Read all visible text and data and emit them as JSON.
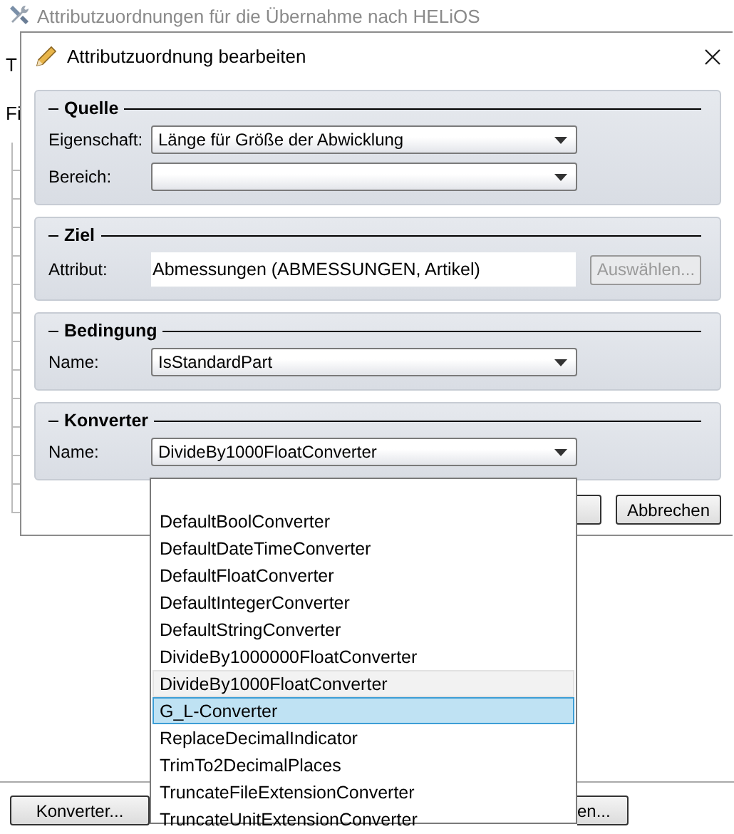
{
  "background_window": {
    "title": "Attributzuordnungen für die Übernahme nach HELiOS",
    "labels": [
      "T",
      "Fi"
    ],
    "buttons": [
      {
        "label": "Konverter..."
      },
      {
        "label": "en..."
      }
    ]
  },
  "dialog": {
    "title": "Attributzuordnung bearbeiten",
    "groups": [
      {
        "title": "Quelle",
        "fields": [
          {
            "kind": "combo",
            "label": "Eigenschaft:",
            "value": "Länge für Größe der Abwicklung"
          },
          {
            "kind": "combo",
            "label": "Bereich:"
          }
        ]
      },
      {
        "title": "Ziel",
        "fields": [
          {
            "kind": "text",
            "label": "Attribut:",
            "value": "Abmessungen (ABMESSUNGEN, Artikel)",
            "button": {
              "label": "Auswählen...",
              "disabled": true
            }
          }
        ]
      },
      {
        "title": "Bedingung",
        "fields": [
          {
            "kind": "combo",
            "label": "Name:",
            "value": "IsStandardPart"
          }
        ]
      },
      {
        "title": "Konverter",
        "fields": [
          {
            "kind": "combo",
            "label": "Name:",
            "value": "DivideBy1000FloatConverter"
          }
        ]
      }
    ],
    "buttons": [
      {
        "label": "Abbrechen"
      }
    ]
  },
  "dropdown": {
    "items": [
      {
        "label": "DefaultBoolConverter",
        "current": false,
        "selected": false
      },
      {
        "label": "DefaultDateTimeConverter",
        "current": false,
        "selected": false
      },
      {
        "label": "DefaultFloatConverter",
        "current": false,
        "selected": false
      },
      {
        "label": "DefaultIntegerConverter",
        "current": false,
        "selected": false
      },
      {
        "label": "DefaultStringConverter",
        "current": false,
        "selected": false
      },
      {
        "label": "DivideBy1000000FloatConverter",
        "current": false,
        "selected": false
      },
      {
        "label": "DivideBy1000FloatConverter",
        "current": true,
        "selected": false
      },
      {
        "label": "G_L-Converter",
        "current": false,
        "selected": true
      },
      {
        "label": "ReplaceDecimalIndicator",
        "current": false,
        "selected": false
      },
      {
        "label": "TrimTo2DecimalPlaces",
        "current": false,
        "selected": false
      },
      {
        "label": "TruncateFileExtensionConverter",
        "current": false,
        "selected": false
      },
      {
        "label": "TruncateUnitExtensionConverter",
        "current": false,
        "selected": false
      }
    ]
  }
}
